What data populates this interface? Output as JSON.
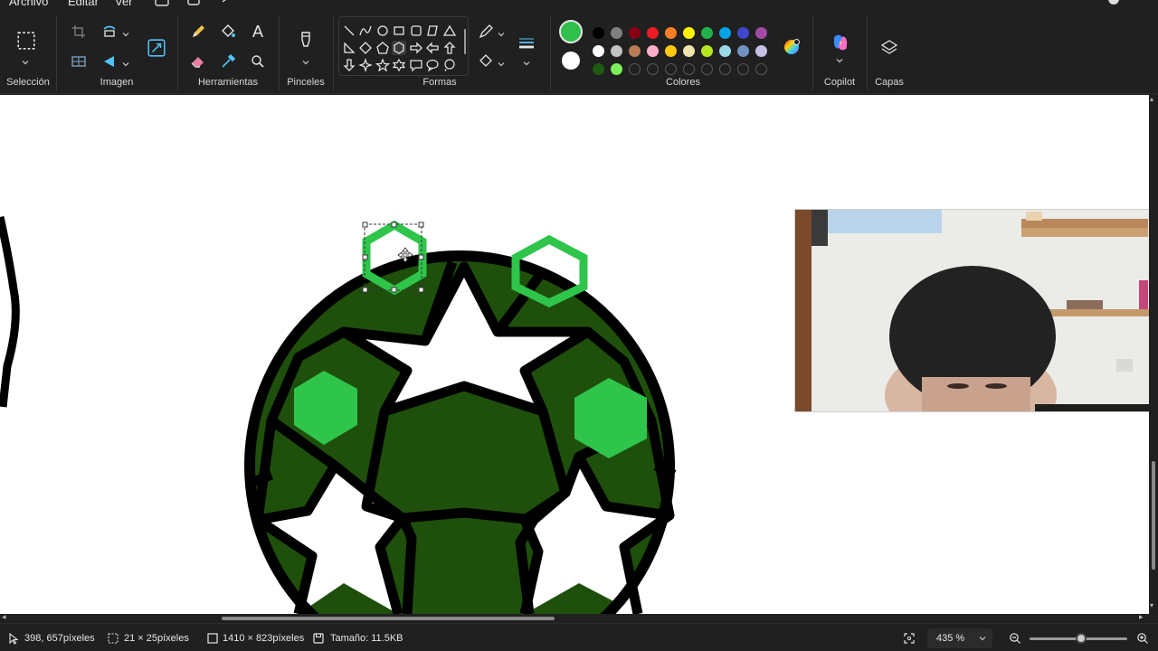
{
  "menu": {
    "file": "Archivo",
    "edit": "Editar",
    "view": "Ver"
  },
  "ribbon": {
    "groups": {
      "selection": "Selección",
      "image": "Imagen",
      "tools": "Herramientas",
      "brushes": "Pinceles",
      "shapes": "Formas",
      "colors": "Colores",
      "copilot": "Copilot",
      "layers": "Capas"
    },
    "text_tool_glyph": "A",
    "current_colors": {
      "primary": "#2fbf4a",
      "secondary": "#ffffff"
    },
    "palette": [
      [
        "#000000",
        "#7f7f7f",
        "#880015",
        "#ed1c24",
        "#ff7f27",
        "#fff200",
        "#22b14c",
        "#00a2e8",
        "#3f48cc",
        "#a349a4"
      ],
      [
        "#ffffff",
        "#c3c3c3",
        "#b97a57",
        "#ffaec9",
        "#ffc90e",
        "#efe4b0",
        "#b5e61d",
        "#99d9ea",
        "#7092be",
        "#c8bfe7"
      ],
      [
        "#1e5a10",
        "#7cf05a",
        "",
        "",
        "",
        "",
        "",
        "",
        "",
        ""
      ]
    ]
  },
  "canvas": {
    "colors": {
      "outline": "#000000",
      "ball_fill": "#1e500c",
      "hex_green": "#2fc54b",
      "background": "#ffffff"
    }
  },
  "status": {
    "cursor_position": "398, 657píxeles",
    "selection_size": "21 × 25píxeles",
    "canvas_size": "1410 × 823píxeles",
    "file_size": "Tamaño: 11.5KB",
    "zoom": "435 %",
    "zoom_level_percent": 435
  }
}
